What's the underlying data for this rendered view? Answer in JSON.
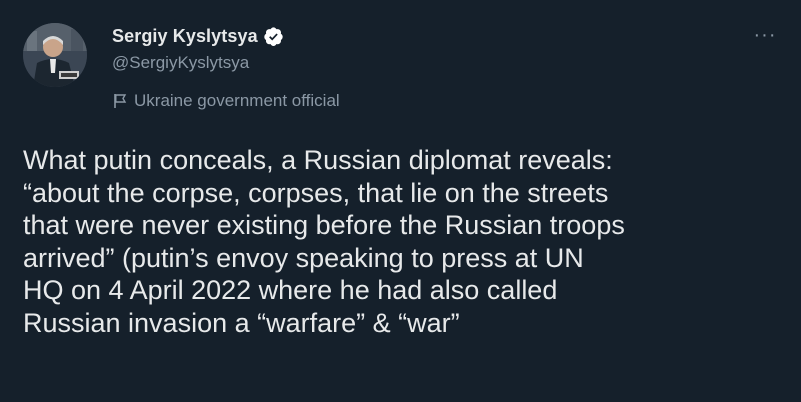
{
  "tweet": {
    "author": {
      "display_name": "Sergiy Kyslytsya",
      "handle": "@SergiyKyslytsya",
      "label": "Ukraine government official",
      "verified": true
    },
    "menu_icon": "more-dots-icon",
    "text": "What putin conceals, a Russian diplomat reveals:\n“about the corpse, corpses, that lie on the streets\nthat were never existing before the Russian troops\narrived” (putin’s envoy speaking to press at UN\nHQ on 4 April 2022 where he had also called\nRussian invasion a “warfare” & “war”",
    "colors": {
      "background": "#15202b",
      "primary_text": "#e7e9ea",
      "secondary_text": "#8b98a5",
      "verified_badge": "#ffffff"
    }
  }
}
